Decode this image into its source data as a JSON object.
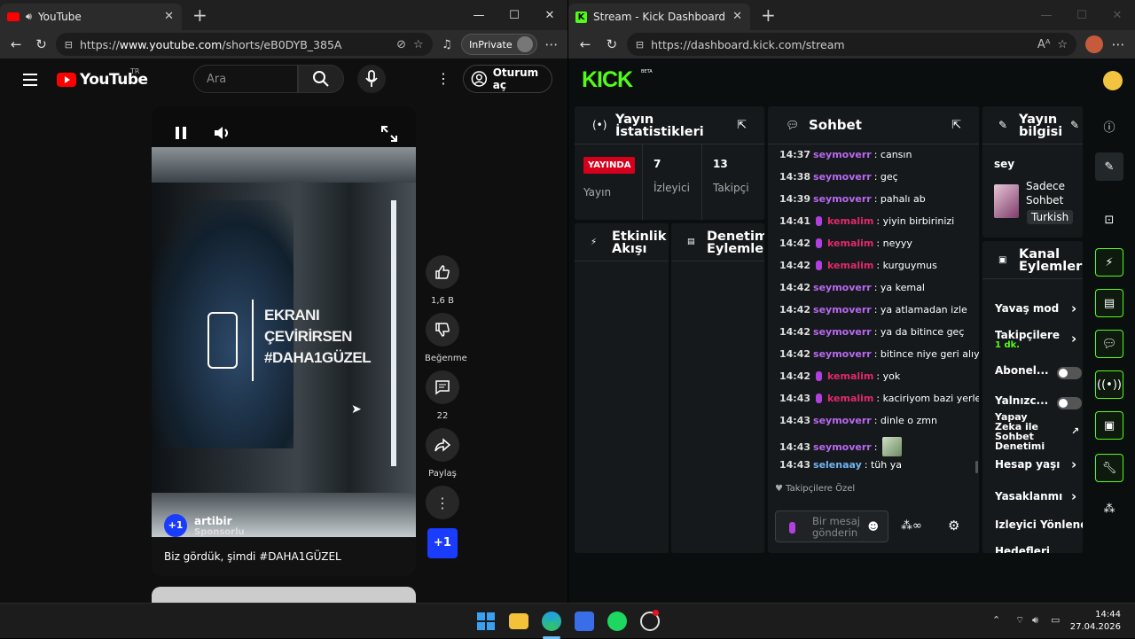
{
  "left_window": {
    "tab_title": "YouTube",
    "url_prefix": "https://",
    "url_host": "www.youtube.com",
    "url_path": "/shorts/eB0DYB_385A",
    "inprivate": "InPrivate"
  },
  "youtube": {
    "logo": "YouTube",
    "region": "TR",
    "search_placeholder": "Ara",
    "signin": "Oturum aç",
    "video_text": [
      "EKRANI",
      "ÇEVİRİRSEN",
      "#DAHA1GÜZEL"
    ],
    "channel_avatar": "+1",
    "channel_name": "artibir",
    "sponsored": "Sponsorlu",
    "caption": "Biz gördük, şimdi #DAHA1GÜZEL",
    "likes": "1,6 B",
    "dislike_label": "Beğenme",
    "comments": "22",
    "share_label": "Paylaş",
    "plus_badge": "+1"
  },
  "right_window": {
    "tab_title": "Stream - Kick Dashboard",
    "url": "https://dashboard.kick.com/stream"
  },
  "kick": {
    "logo": "KICK",
    "beta": "BETA",
    "stats": {
      "title_line1": "Yayın",
      "title_line2": "İstatistikleri",
      "live_badge": "YAYINDA",
      "live_label": "Yayın",
      "viewers_value": "7",
      "viewers_label": "İzleyici",
      "followers_value": "13",
      "followers_label": "Takipçi"
    },
    "activity": {
      "line1": "Etkinlik",
      "line2": "Akışı"
    },
    "moderation": {
      "line1": "Denetim",
      "line2": "Eylemleri"
    },
    "chat": {
      "title": "Sohbet",
      "messages": [
        {
          "time": "14:37",
          "user": "seymoverr",
          "text": ": cansın",
          "color": "#b868f0",
          "mic": false
        },
        {
          "time": "14:38",
          "user": "seymoverr",
          "text": ": geç",
          "color": "#b868f0",
          "mic": false
        },
        {
          "time": "14:39",
          "user": "seymoverr",
          "text": ": pahalı ab",
          "color": "#b868f0",
          "mic": false
        },
        {
          "time": "14:41",
          "user": "kemalim",
          "text": ": yiyin birbirinizi",
          "color": "#e0296a",
          "mic": true
        },
        {
          "time": "14:42",
          "user": "kemalim",
          "text": ": neyyy",
          "color": "#e0296a",
          "mic": true
        },
        {
          "time": "14:42",
          "user": "kemalim",
          "text": ": kurguymus",
          "color": "#e0296a",
          "mic": true
        },
        {
          "time": "14:42",
          "user": "seymoverr",
          "text": ": ya kemal",
          "color": "#b868f0",
          "mic": false
        },
        {
          "time": "14:42",
          "user": "seymoverr",
          "text": ": ya atlamadan izle",
          "color": "#b868f0",
          "mic": false
        },
        {
          "time": "14:42",
          "user": "seymoverr",
          "text": ": ya da bitince geç",
          "color": "#b868f0",
          "mic": false
        },
        {
          "time": "14:42",
          "user": "seymoverr",
          "text": ": bitince niye geri alıyon",
          "color": "#b868f0",
          "mic": false
        },
        {
          "time": "14:42",
          "user": "kemalim",
          "text": ": yok",
          "color": "#e0296a",
          "mic": true
        },
        {
          "time": "14:43",
          "user": "kemalim",
          "text": ": kaciriyom bazi yerleri",
          "color": "#e0296a",
          "mic": true
        },
        {
          "time": "14:43",
          "user": "seymoverr",
          "text": ": dinle o zmn",
          "color": "#b868f0",
          "mic": false
        },
        {
          "time": "14:43",
          "user": "seymoverr",
          "text": ":",
          "color": "#b868f0",
          "mic": false
        },
        {
          "time": "14:43",
          "user": "selenaay",
          "text": ": tüh ya",
          "color": "#6fb4f2",
          "mic": false
        }
      ],
      "followers_only": "Takipçilere Özel",
      "input_placeholder_1": "Bir mesaj",
      "input_placeholder_2": "gönderin"
    },
    "stream_info": {
      "title_line1": "Yayın",
      "title_line2": "bilgisi",
      "stream_title": "sey",
      "category_line1": "Sadece",
      "category_line2": "Sohbet",
      "language": "Turkish"
    },
    "channel_actions": {
      "title_line1": "Kanal",
      "title_line2": "Eylemleri",
      "slow_mode": "Yavaş mod",
      "followers_line1": "Takipçilere",
      "followers_line2": "1 dk.",
      "subscribers": "Abonel...",
      "emotes": "Yalnızc...",
      "ai_line1": "Yapay",
      "ai_line2": "Zeka ile",
      "ai_line3": "Sohbet",
      "ai_line4": "Denetimi",
      "account_age": "Hesap yaşı",
      "banned": "Yasaklanmı",
      "viewer_redirect": "İzleyici Yönlendir",
      "goals": "Hedefleri"
    }
  },
  "taskbar": {
    "time": "14:44",
    "date": "27.04.2026"
  }
}
